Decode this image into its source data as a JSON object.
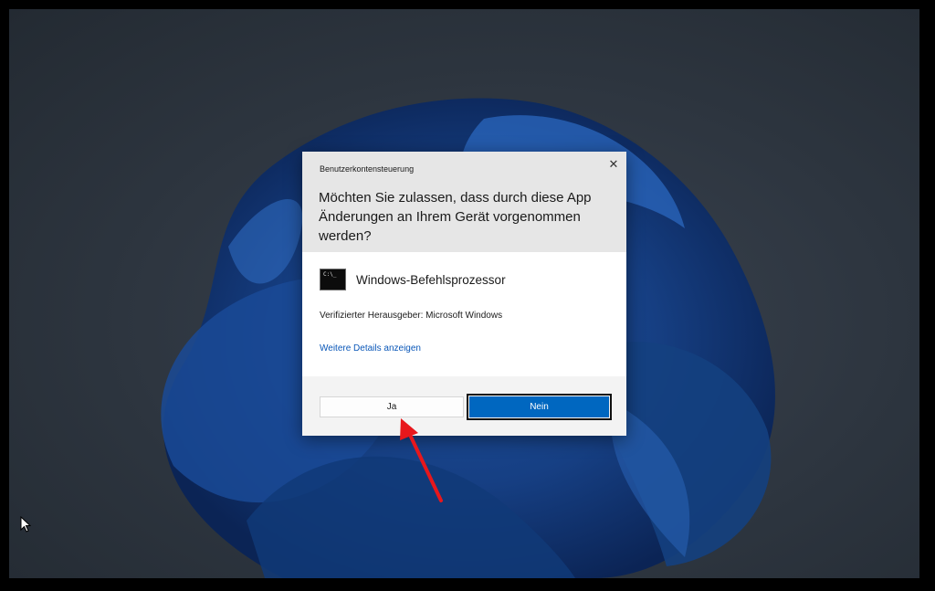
{
  "dialog": {
    "app_title": "Benutzerkontensteuerung",
    "question": "Möchten Sie zulassen, dass durch diese App Änderungen an Ihrem Gerät vorgenommen werden?",
    "app_name": "Windows-Befehlsprozessor",
    "app_icon_text": "C:\\_",
    "publisher": "Verifizierter Herausgeber: Microsoft Windows",
    "details_link": "Weitere Details anzeigen",
    "close_glyph": "✕",
    "yes_label": "Ja",
    "no_label": "Nein"
  },
  "colors": {
    "accent": "#0067c0",
    "link": "#0a57b8",
    "annotation_arrow": "#e8171c"
  },
  "icons": {
    "app": "command-prompt-icon",
    "close": "close-icon",
    "cursor": "mouse-pointer-icon"
  }
}
